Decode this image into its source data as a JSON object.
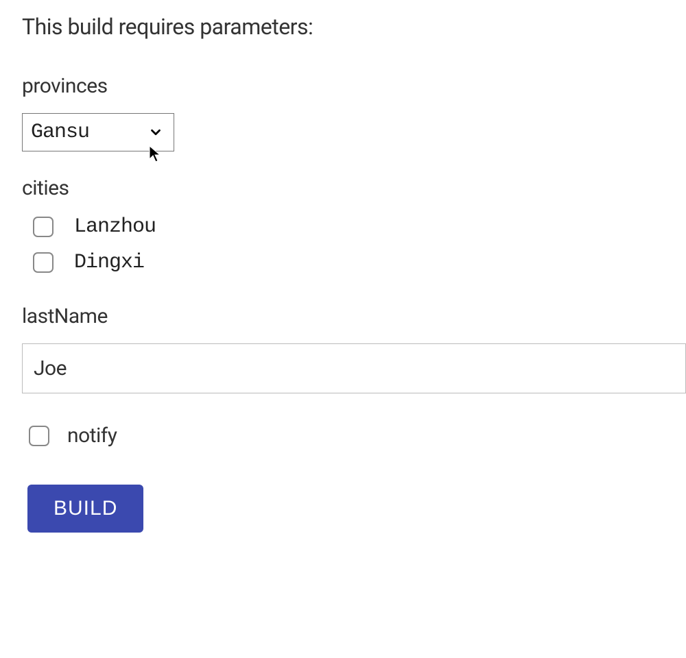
{
  "heading": "This build requires parameters:",
  "params": {
    "provinces": {
      "label": "provinces",
      "selected": "Gansu"
    },
    "cities": {
      "label": "cities",
      "items": [
        {
          "label": "Lanzhou",
          "checked": false
        },
        {
          "label": "Dingxi",
          "checked": false
        }
      ]
    },
    "lastName": {
      "label": "lastName",
      "value": "Joe"
    },
    "notify": {
      "label": "notify",
      "checked": false
    }
  },
  "actions": {
    "build_label": "BUILD"
  }
}
